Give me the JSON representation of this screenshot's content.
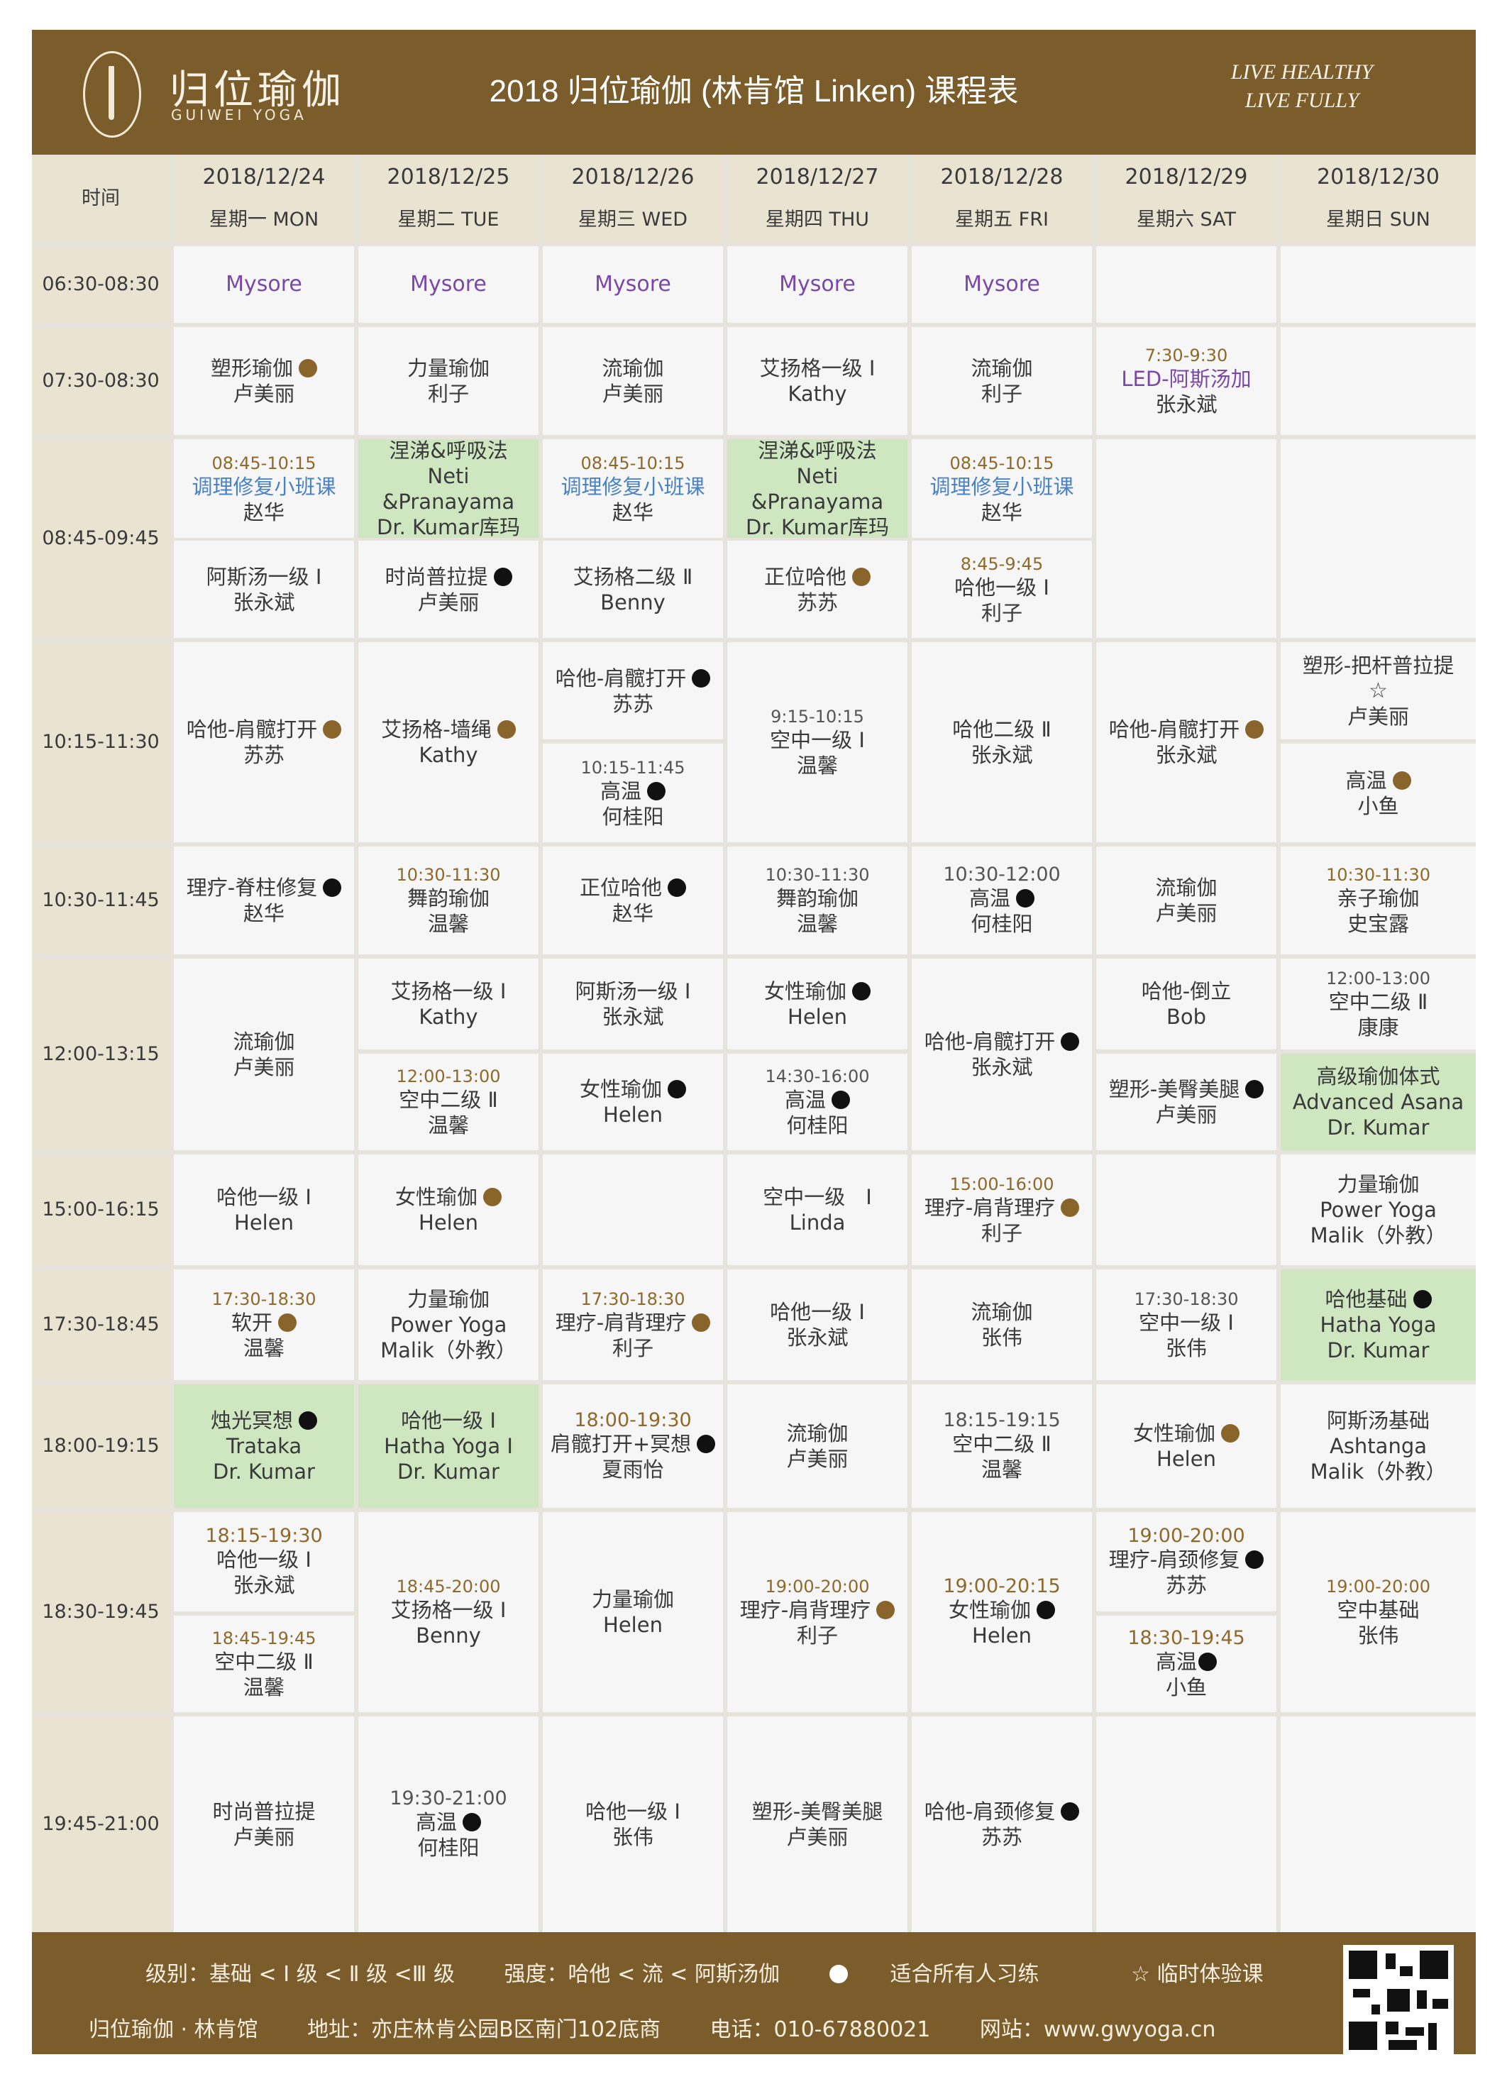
{
  "header": {
    "logo_cn": "归位瑜伽",
    "logo_en": "GUIWEI YOGA",
    "title": "2018 归位瑜伽 (林肯馆 Linken) 课程表",
    "slogan1": "LIVE HEALTHY",
    "slogan2": "LIVE FULLY"
  },
  "table": {
    "time_header": "时间",
    "days": [
      {
        "date": "2018/12/24",
        "week": "星期一 MON"
      },
      {
        "date": "2018/12/25",
        "week": "星期二 TUE"
      },
      {
        "date": "2018/12/26",
        "week": "星期三 WED"
      },
      {
        "date": "2018/12/27",
        "week": "星期四 THU"
      },
      {
        "date": "2018/12/28",
        "week": "星期五 FRI"
      },
      {
        "date": "2018/12/29",
        "week": "星期六 SAT"
      },
      {
        "date": "2018/12/30",
        "week": "星期日 SUN"
      }
    ],
    "times": [
      "06:30-08:30",
      "07:30-08:30",
      "08:45-09:45",
      "10:15-11:30",
      "10:30-11:45",
      "12:00-13:15",
      "15:00-16:15",
      "17:30-18:45",
      "18:00-19:15",
      "18:30-19:45",
      "19:45-21:00"
    ],
    "mysore": "Mysore",
    "cells": {
      "r1": {
        "mon": {
          "l1": "塑形瑜伽",
          "l2": "卢美丽"
        },
        "tue": {
          "l1": "力量瑜伽",
          "l2": "利子"
        },
        "wed": {
          "l1": "流瑜伽",
          "l2": "卢美丽"
        },
        "thu": {
          "l1": "艾扬格一级 Ⅰ",
          "l2": "Kathy"
        },
        "fri": {
          "l1": "流瑜伽",
          "l2": "利子"
        },
        "sat": {
          "t": "7:30-9:30",
          "l1": "LED-阿斯汤加",
          "l2": "张永斌"
        }
      },
      "r2": {
        "mon_a": {
          "t": "08:45-10:15",
          "l1": "调理修复小班课",
          "l2": "赵华"
        },
        "tue_a": {
          "l1": "涅涕&呼吸法",
          "l2": "Neti &Pranayama",
          "l3": "Dr. Kumar库玛"
        },
        "wed_a": {
          "t": "08:45-10:15",
          "l1": "调理修复小班课",
          "l2": "赵华"
        },
        "thu_a": {
          "l1": "涅涕&呼吸法",
          "l2": "Neti &Pranayama",
          "l3": "Dr. Kumar库玛"
        },
        "fri_a": {
          "t": "08:45-10:15",
          "l1": "调理修复小班课",
          "l2": "赵华"
        },
        "mon_b": {
          "l1": "阿斯汤一级 Ⅰ",
          "l2": "张永斌"
        },
        "tue_b": {
          "l1": "时尚普拉提",
          "l2": "卢美丽"
        },
        "wed_b": {
          "l1": "艾扬格二级 Ⅱ",
          "l2": "Benny"
        },
        "thu_b": {
          "l1": "正位哈他",
          "l2": "苏苏"
        },
        "fri_b": {
          "t": "8:45-9:45",
          "l1": "哈他一级 Ⅰ",
          "l2": "利子"
        }
      },
      "r3": {
        "mon": {
          "l1": "哈他-肩髋打开",
          "l2": "苏苏"
        },
        "tue": {
          "l1": "艾扬格-墙绳",
          "l2": "Kathy"
        },
        "wed_a": {
          "l1": "哈他-肩髋打开",
          "l2": "苏苏"
        },
        "wed_b": {
          "t": "10:15-11:45",
          "l1": "高温",
          "l2": "何桂阳"
        },
        "thu": {
          "t": "9:15-10:15",
          "l1": "空中一级 Ⅰ",
          "l2": "温馨"
        },
        "fri": {
          "l1": "哈他二级 Ⅱ",
          "l2": "张永斌"
        },
        "sat": {
          "l1": "哈他-肩髋打开",
          "l2": "张永斌"
        },
        "sun_a": {
          "l1": "塑形-把杆普拉提",
          "l2": "☆",
          "l3": "卢美丽"
        },
        "sun_b": {
          "l1": "高温",
          "l2": "小鱼"
        }
      },
      "r4": {
        "mon": {
          "l1": "理疗-脊柱修复",
          "l2": "赵华"
        },
        "tue": {
          "t": "10:30-11:30",
          "l1": "舞韵瑜伽",
          "l2": "温馨"
        },
        "wed": {
          "l1": "正位哈他",
          "l2": "赵华"
        },
        "thu": {
          "t": "10:30-11:30",
          "l1": "舞韵瑜伽",
          "l2": "温馨"
        },
        "fri": {
          "t": "10:30-12:00",
          "l1": "高温",
          "l2": "何桂阳"
        },
        "sat": {
          "l1": "流瑜伽",
          "l2": "卢美丽"
        },
        "sun": {
          "t": "10:30-11:30",
          "l1": "亲子瑜伽",
          "l2": "史宝露"
        }
      },
      "r5": {
        "mon": {
          "l1": "流瑜伽",
          "l2": "卢美丽"
        },
        "tue_a": {
          "l1": "艾扬格一级 Ⅰ",
          "l2": "Kathy"
        },
        "tue_b": {
          "t": "12:00-13:00",
          "l1": "空中二级 Ⅱ",
          "l2": "温馨"
        },
        "wed_a": {
          "l1": "阿斯汤一级 Ⅰ",
          "l2": "张永斌"
        },
        "wed_b": {
          "l1": "女性瑜伽",
          "l2": "Helen"
        },
        "thu_a": {
          "l1": "女性瑜伽",
          "l2": "Helen"
        },
        "thu_b": {
          "t": "14:30-16:00",
          "l1": "高温",
          "l2": "何桂阳"
        },
        "fri": {
          "l1": "哈他-肩髋打开",
          "l2": "张永斌"
        },
        "sat_a": {
          "l1": "哈他-倒立",
          "l2": "Bob"
        },
        "sat_b": {
          "l1": "塑形-美臀美腿",
          "l2": "卢美丽"
        },
        "sun_a": {
          "t": "12:00-13:00",
          "l1": "空中二级 Ⅱ",
          "l2": "康康"
        },
        "sun_b": {
          "l1": "高级瑜伽体式",
          "l2": "Advanced Asana",
          "l3": "Dr. Kumar"
        }
      },
      "r6": {
        "mon": {
          "l1": "哈他一级 Ⅰ",
          "l2": "Helen"
        },
        "tue": {
          "l1": "女性瑜伽",
          "l2": "Helen"
        },
        "thu": {
          "l1": "空中一级　Ⅰ",
          "l2": "Linda"
        },
        "fri": {
          "t": "15:00-16:00",
          "l1": "理疗-肩背理疗",
          "l2": "利子"
        },
        "sun": {
          "l1": "力量瑜伽",
          "l2": "Power Yoga",
          "l3": "Malik（外教）"
        }
      },
      "r7": {
        "mon": {
          "t": "17:30-18:30",
          "l1": "软开",
          "l2": "温馨"
        },
        "tue": {
          "l1": "力量瑜伽",
          "l2": "Power Yoga",
          "l3": "Malik（外教）"
        },
        "wed": {
          "t": "17:30-18:30",
          "l1": "理疗-肩背理疗",
          "l2": "利子"
        },
        "thu": {
          "l1": "哈他一级 Ⅰ",
          "l2": "张永斌"
        },
        "fri": {
          "l1": "流瑜伽",
          "l2": "张伟"
        },
        "sat": {
          "t": "17:30-18:30",
          "l1": "空中一级 Ⅰ",
          "l2": "张伟"
        },
        "sun": {
          "l1": "哈他基础",
          "l2": "Hatha Yoga",
          "l3": "Dr. Kumar"
        }
      },
      "r8": {
        "mon": {
          "l1": "烛光冥想",
          "l2": "Trataka",
          "l3": "Dr. Kumar"
        },
        "tue": {
          "l1": "哈他一级 Ⅰ",
          "l2": "Hatha Yoga Ⅰ",
          "l3": "Dr. Kumar"
        },
        "wed": {
          "t": "18:00-19:30",
          "l1": "肩髋打开+冥想",
          "l2": "夏雨怡"
        },
        "thu": {
          "l1": "流瑜伽",
          "l2": "卢美丽"
        },
        "fri": {
          "t": "18:15-19:15",
          "l1": "空中二级 Ⅱ",
          "l2": "温馨"
        },
        "sat": {
          "l1": "女性瑜伽",
          "l2": "Helen"
        },
        "sun": {
          "l1": "阿斯汤基础",
          "l2": "Ashtanga",
          "l3": "Malik（外教）"
        }
      },
      "r9": {
        "mon_a": {
          "t": "18:15-19:30",
          "l1": "哈他一级 Ⅰ",
          "l2": "张永斌"
        },
        "mon_b": {
          "t": "18:45-19:45",
          "l1": "空中二级 Ⅱ",
          "l2": "温馨"
        },
        "tue": {
          "t": "18:45-20:00",
          "l1": "艾扬格一级 Ⅰ",
          "l2": "Benny"
        },
        "wed": {
          "l1": "力量瑜伽",
          "l2": "Helen"
        },
        "thu": {
          "t": "19:00-20:00",
          "l1": "理疗-肩背理疗",
          "l2": "利子"
        },
        "fri": {
          "t": "19:00-20:15",
          "l1": "女性瑜伽",
          "l2": "Helen"
        },
        "sat_a": {
          "t": "19:00-20:00",
          "l1": "理疗-肩颈修复",
          "l2": "苏苏"
        },
        "sat_b": {
          "t": "18:30-19:45",
          "l1": "高温",
          "l2": "小鱼"
        },
        "sun": {
          "t": "19:00-20:00",
          "l1": "空中基础",
          "l2": "张伟"
        }
      },
      "r10": {
        "mon": {
          "l1": "时尚普拉提",
          "l2": "卢美丽"
        },
        "tue": {
          "t": "19:30-21:00",
          "l1": "高温",
          "l2": "何桂阳"
        },
        "wed": {
          "l1": "哈他一级 Ⅰ",
          "l2": "张伟"
        },
        "thu": {
          "l1": "塑形-美臀美腿",
          "l2": "卢美丽"
        },
        "fri": {
          "l1": "哈他-肩颈修复",
          "l2": "苏苏"
        }
      }
    }
  },
  "footer": {
    "level": "级别：基础 < Ⅰ 级 < Ⅱ 级 <Ⅲ 级",
    "intensity": "强度：哈他 < 流 < 阿斯汤伽",
    "all": "适合所有人习练",
    "trial": "☆  临时体验课",
    "studio": "归位瑜伽 · 林肯馆",
    "address": "地址：亦庄林肯公园B区南门102底商",
    "phone": "电话：010-67880021",
    "website": "网站：www.gwyoga.cn"
  },
  "colors": {
    "brand": "#7b5d2c",
    "header_bg": "#eae3d1",
    "green": "#cfe7c1",
    "time_text": "#8d6a2c",
    "blue_text": "#4a82c3",
    "purple_text": "#7a48a6"
  },
  "icons": {
    "dot_black": "black-dot-icon",
    "dot_brown": "brown-dot-icon",
    "qr": "qr-code-icon"
  }
}
